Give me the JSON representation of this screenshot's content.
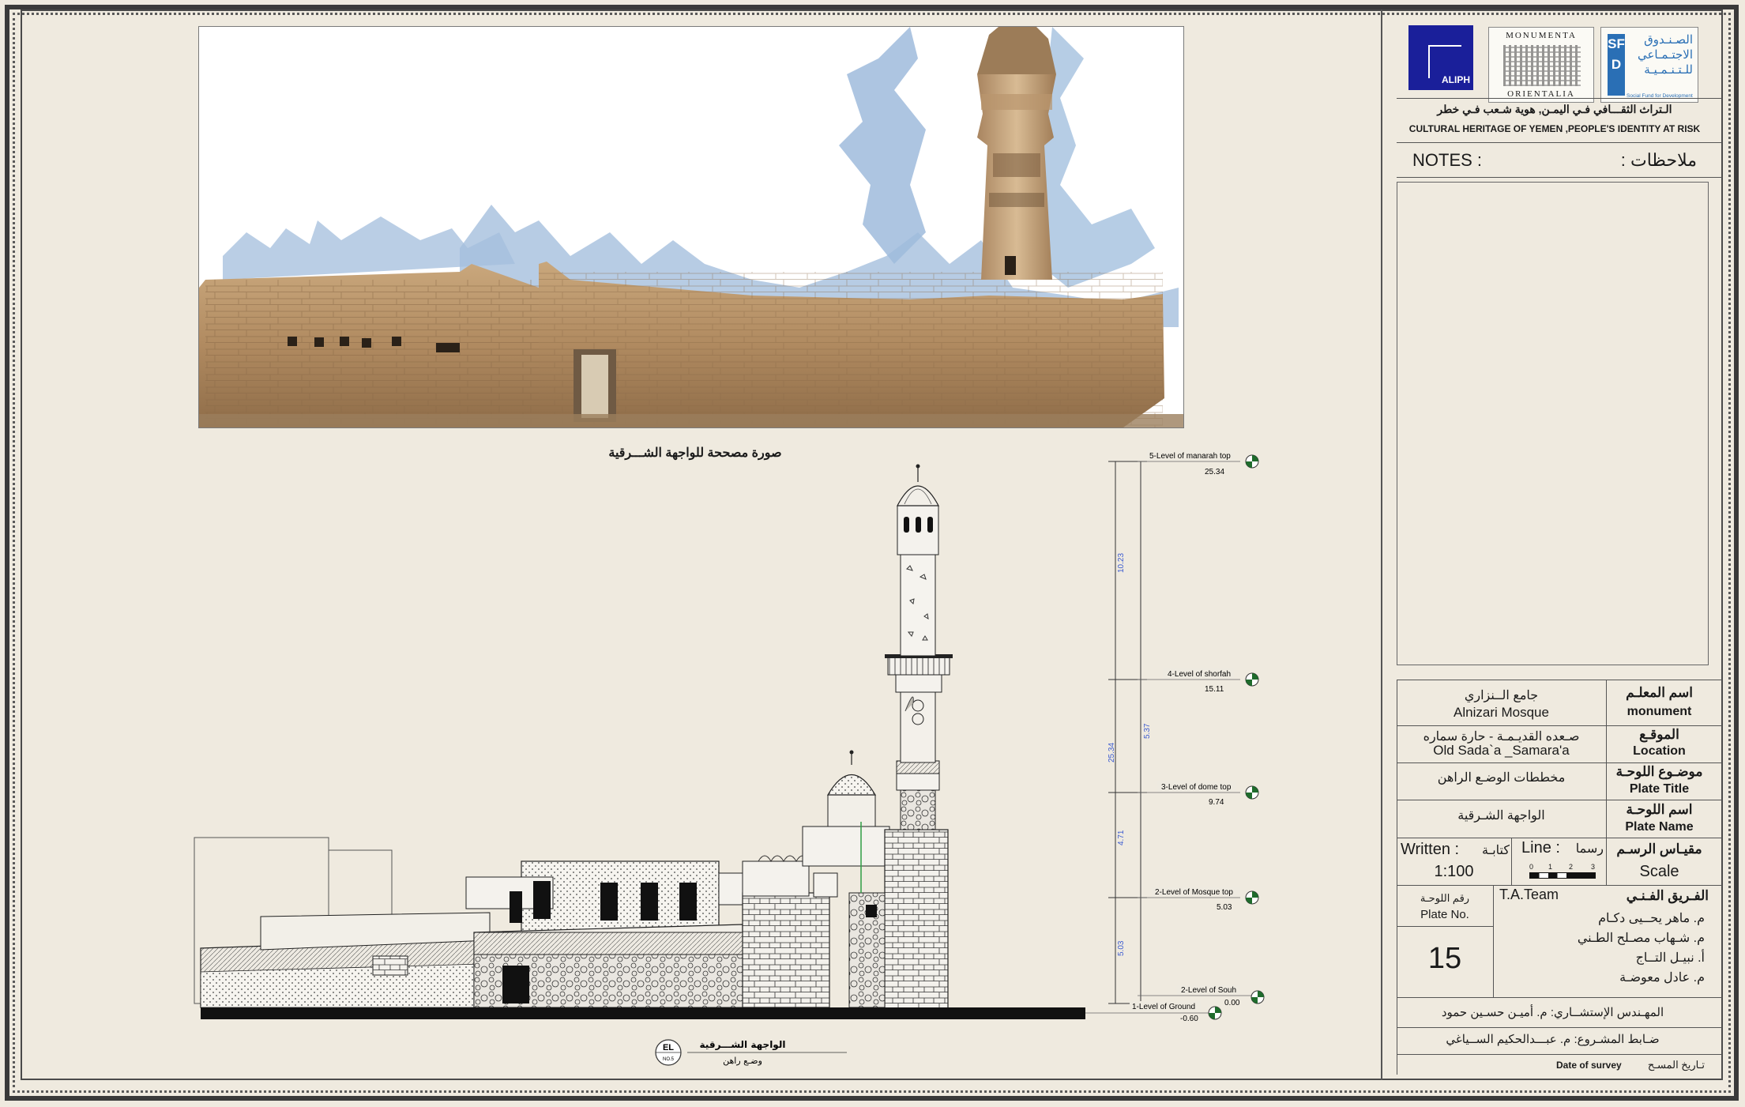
{
  "photo": {
    "caption": "صورة مصححة للواجهة الشـــرقية"
  },
  "drawing": {
    "title_ar": "الواجهة الشـــرقية",
    "subtitle_ar": "وضـع راهن",
    "elevation_mark": "EL",
    "elevation_no": "NO.5",
    "levels": [
      {
        "label": "5-Level of manarah top",
        "value": "25.34"
      },
      {
        "label": "4-Level of shorfah",
        "value": "15.11"
      },
      {
        "label": "3-Level of dome top",
        "value": "9.74"
      },
      {
        "label": "2-Level of Mosque top",
        "value": "5.03"
      },
      {
        "label": "2-Level of Souh",
        "value": "0.00"
      },
      {
        "label": "1-Level of Ground",
        "value": "-0.60"
      }
    ],
    "dimensions": {
      "seg1": "10.23",
      "seg2": "5.37",
      "seg3": "4.71",
      "seg4": "5.03",
      "total": "25.34"
    }
  },
  "title_block": {
    "logos": {
      "aliph": "ALIPH",
      "monumenta_top": "MONUMENTA",
      "monumenta_bottom": "ORIENTALIA",
      "sfd_letters": "SFD",
      "sfd_ar_1": "الصـنـدوق",
      "sfd_ar_2": "الاجتـمـاعي",
      "sfd_ar_3": "للـتـنـمـيـة",
      "sfd_en": "Social Fund for Development"
    },
    "project_ar": "الـتراث الثقـــافي فـي اليمـن, هوية شـعب فـي خطر",
    "project_en": "CULTURAL HERITAGE OF YEMEN ,PEOPLE'S IDENTITY AT RISK",
    "notes_en": "NOTES :",
    "notes_ar": "ملاحظات :",
    "monument_label_ar": "اسم المعلـم",
    "monument_label_en": "monument",
    "monument_value_ar": "جامع الــنزاري",
    "monument_value_en": "Alnizari Mosque",
    "location_label_ar": "الموقـع",
    "location_label_en": "Location",
    "location_value_ar": "صـعده القديـمـة - حارة سماره",
    "location_value_en": "Old Sada`a  _Samara'a",
    "plate_title_label_ar": "موضـوع اللوحـة",
    "plate_title_label_en": "Plate Title",
    "plate_title_value_ar": "مخططات الوضـع الراهن",
    "plate_name_label_ar": "اسم اللوحـة",
    "plate_name_label_en": "Plate Name",
    "plate_name_value_ar": "الواجهة الشـرقية",
    "scale_label_ar": "مقيـاس الرسـم",
    "scale_label_en": "Scale",
    "written_en": "Written :",
    "written_ar": "كتابـة",
    "written_value": "1:100",
    "line_en": "Line :",
    "line_ar": "رسما",
    "scale_bar_ticks": [
      "0",
      "1",
      "2",
      "3"
    ],
    "plate_no_ar": "رقم اللوحـة",
    "plate_no_en": "Plate No.",
    "plate_no_value": "15",
    "team_label_ar": "الفـريق الفـنـي",
    "team_label_en": "T.A.Team",
    "team_members": [
      "م. ماهر يحــيى دكـام",
      "م. شـهاب مصـلح الطـني",
      "أ. نبيـل التــاج",
      "م. عادل معوضـة"
    ],
    "consultant": "المهـندس الإستشــاري: م. أميـن حسـين حمود",
    "supervisor": "ضـابط المشـروع: م. عبـــدالحكيم الســياغي",
    "date_en": "Date of survey",
    "date_ar": "تـاريخ المسـح"
  }
}
